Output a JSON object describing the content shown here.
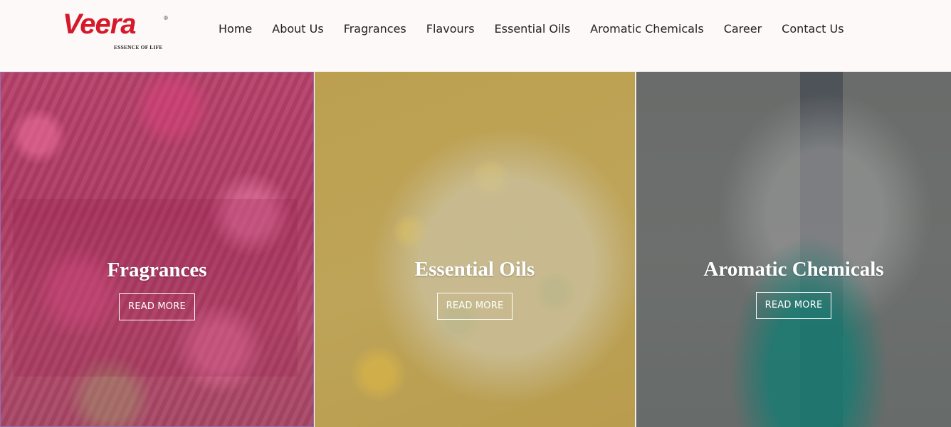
{
  "brand": {
    "name": "Veera",
    "registered_mark": "®",
    "tagline": "ESSENCE OF LIFE",
    "color": "#d5192a"
  },
  "nav": {
    "items": [
      {
        "label": "Home"
      },
      {
        "label": "About Us"
      },
      {
        "label": "Fragrances"
      },
      {
        "label": "Flavours"
      },
      {
        "label": "Essential Oils"
      },
      {
        "label": "Aromatic Chemicals"
      },
      {
        "label": "Career"
      },
      {
        "label": "Contact Us"
      }
    ]
  },
  "panels": [
    {
      "title": "Fragrances",
      "button_label": "READ MORE"
    },
    {
      "title": "Essential Oils",
      "button_label": "READ MORE"
    },
    {
      "title": "Aromatic Chemicals",
      "button_label": "READ MORE"
    }
  ]
}
